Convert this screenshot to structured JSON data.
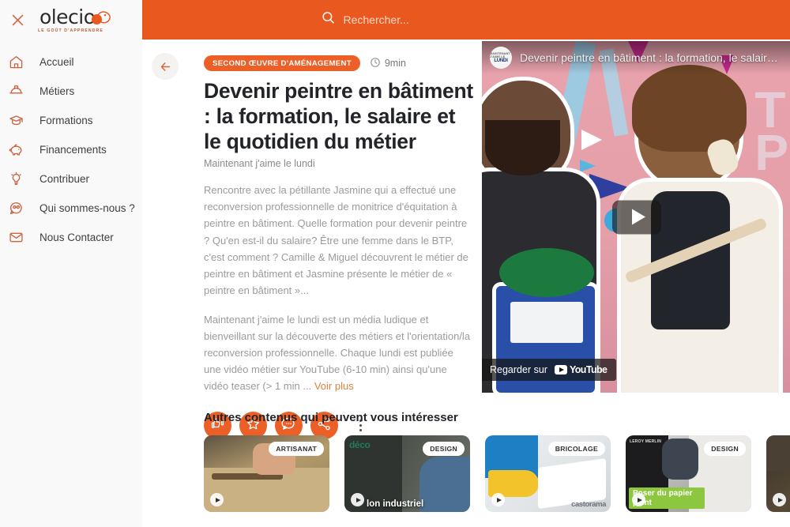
{
  "sidebar": {
    "close_icon": "close-icon",
    "logo": {
      "word": "olecio",
      "tagline": "LE GOÛT D'APPRENDRE"
    },
    "items": [
      {
        "label": "Accueil",
        "icon": "home-icon"
      },
      {
        "label": "Métiers",
        "icon": "hard-hat-icon"
      },
      {
        "label": "Formations",
        "icon": "graduation-cap-icon"
      },
      {
        "label": "Financements",
        "icon": "piggy-bank-icon"
      },
      {
        "label": "Contribuer",
        "icon": "lightbulb-icon"
      },
      {
        "label": "Qui sommes-nous ?",
        "icon": "people-chat-icon"
      },
      {
        "label": "Nous Contacter",
        "icon": "envelope-icon"
      }
    ]
  },
  "header": {
    "search_placeholder": "Rechercher...",
    "search_value": "",
    "search_icon": "search-icon",
    "bar_color": "#e8581f"
  },
  "article": {
    "back_label": "Retour",
    "category": "SECOND ŒUVRE D'AMÉNAGEMENT",
    "read_time": "9min",
    "clock_icon": "clock-icon",
    "title": "Devenir peintre en bâtiment : la formation, le salaire et le quotidien du métier",
    "source": "Maintenant j'aime le lundi",
    "paragraph_1": "Rencontre avec la pétillante Jasmine qui a effectué une reconversion professionnelle de monitrice d'équitation à peintre en bâtiment. Quelle formation pour devenir peintre ? Qu'en est-il du salaire? Être une femme dans le BTP, c'est comment ? Camille & Miguel découvrent le métier de peintre en bâtiment et Jasmine présente le métier de « peintre en bâtiment »...",
    "paragraph_2": "Maintenant j'aime le lundi est un média ludique et bienveillant sur la découverte des métiers et l'orientation/la reconversion professionnelle. Chaque lundi est publiée une vidéo métier sur YouTube (6-10 min) ainsi qu'une vidéo teaser (> 1 min ... ",
    "more_link": "Voir plus",
    "actions": [
      {
        "name": "like-button",
        "icon": "thumbs-up-down-icon"
      },
      {
        "name": "favorite-button",
        "icon": "star-icon"
      },
      {
        "name": "comment-button",
        "icon": "comment-bubble-icon"
      },
      {
        "name": "share-button",
        "icon": "share-icon"
      }
    ],
    "more_menu_icon": "kebab-menu-icon",
    "accent_color": "#ec5f27"
  },
  "video": {
    "channel_avatar_line1": "MAINTENANT J'AIME LE",
    "channel_avatar_line2": "LUNDI",
    "title": "Devenir peintre en bâtiment : la formation, le salaire ...",
    "play_icon": "play-icon",
    "watch_label": "Regarder sur",
    "platform": "YouTube"
  },
  "recommendations": {
    "heading": "Autres contenus qui peuvent vous intéresser",
    "cards": [
      {
        "tag": "ARTISANAT",
        "caption": "",
        "brand": "",
        "play_icon": "play-icon"
      },
      {
        "tag": "DESIGN",
        "caption": "lon industriel",
        "brand": "déco",
        "play_icon": "play-icon"
      },
      {
        "tag": "BRICOLAGE",
        "caption": "",
        "brand": "castorama",
        "play_icon": "play-icon"
      },
      {
        "tag": "DESIGN",
        "caption": "Poser du papier peint",
        "brand": "LEROY MERLIN",
        "play_icon": "play-icon"
      },
      {
        "tag": "",
        "caption": "",
        "brand": "",
        "play_icon": "play-icon"
      }
    ]
  }
}
